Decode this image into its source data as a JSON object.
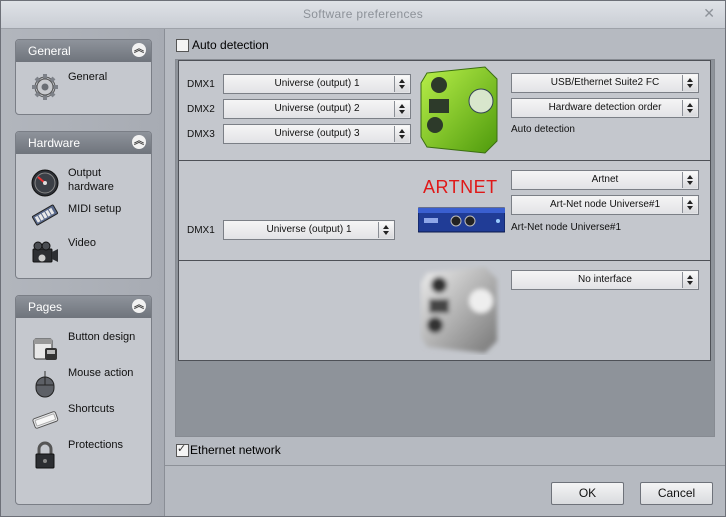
{
  "window": {
    "title": "Software preferences",
    "close_glyph": "✕"
  },
  "sidebar": {
    "general": {
      "title": "General",
      "items": [
        {
          "label": "General",
          "icon": "gear-icon"
        }
      ]
    },
    "hardware": {
      "title": "Hardware",
      "items": [
        {
          "label": "Output hardware",
          "icon": "speedometer-icon"
        },
        {
          "label": "MIDI setup",
          "icon": "keyboard-icon"
        },
        {
          "label": "Video",
          "icon": "film-camera-icon"
        }
      ]
    },
    "pages": {
      "title": "Pages",
      "items": [
        {
          "label": "Button design",
          "icon": "paint-bucket-icon"
        },
        {
          "label": "Mouse action",
          "icon": "mouse-icon"
        },
        {
          "label": "Shortcuts",
          "icon": "keyboard-key-icon"
        },
        {
          "label": "Protections",
          "icon": "padlock-icon"
        }
      ]
    },
    "collapse_glyph": "︽"
  },
  "main": {
    "auto_detection": {
      "label": "Auto detection",
      "checked": false
    },
    "section1": {
      "dmx": [
        {
          "label": "DMX1",
          "value": "Universe (output) 1"
        },
        {
          "label": "DMX2",
          "value": "Universe (output) 2"
        },
        {
          "label": "DMX3",
          "value": "Universe (output) 3"
        }
      ],
      "interface": "USB/Ethernet Suite2 FC",
      "mode": "Hardware detection order",
      "status": "Auto detection",
      "device_color": "#7fd21c"
    },
    "section2": {
      "heading": "ARTNET",
      "heading_color": "#e01818",
      "dmx": [
        {
          "label": "DMX1",
          "value": "Universe (output) 1"
        }
      ],
      "interface": "Artnet",
      "node": "Art-Net node Universe#1",
      "status": "Art-Net node Universe#1"
    },
    "section3": {
      "interface": "No interface"
    },
    "ethernet_network": {
      "label": "Ethernet network",
      "checked": true
    }
  },
  "footer": {
    "ok_label": "OK",
    "cancel_label": "Cancel"
  }
}
